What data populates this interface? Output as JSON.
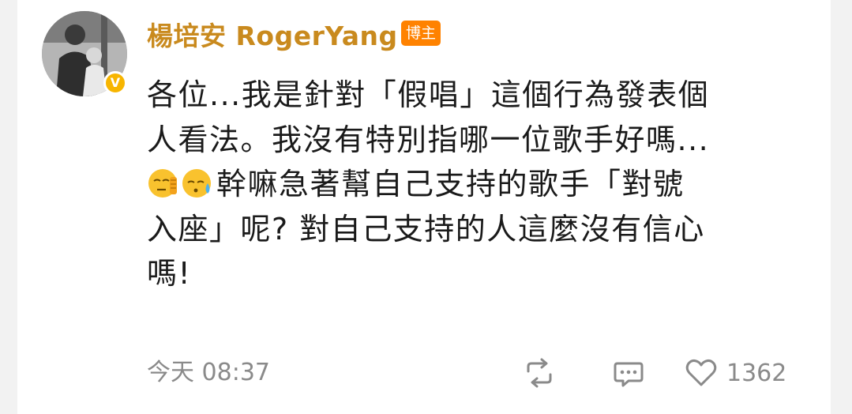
{
  "post": {
    "author": {
      "name": "楊培安 RogerYang",
      "role_badge": "博主",
      "verified_badge": "V"
    },
    "text_lines": [
      "各位...我是針對「假唱」這個行為發表個",
      "人看法。我沒有特別指哪一位歌手好嗎...",
      "幹嘛急著幫自己支持的歌手「對號",
      "入座」呢? 對自己支持的人這麼沒有信心",
      "嗎!"
    ],
    "emojis": [
      "face-palm-emoji",
      "sweat-emoji"
    ],
    "timestamp": "今天 08:37",
    "like_count": "1362"
  },
  "colors": {
    "author_name": "#c98a1e",
    "role_badge_bg": "#ff8200",
    "verified_badge_bg": "#f7b500",
    "meta_text": "#8a8a8a",
    "body_text": "#1a1a1a"
  }
}
